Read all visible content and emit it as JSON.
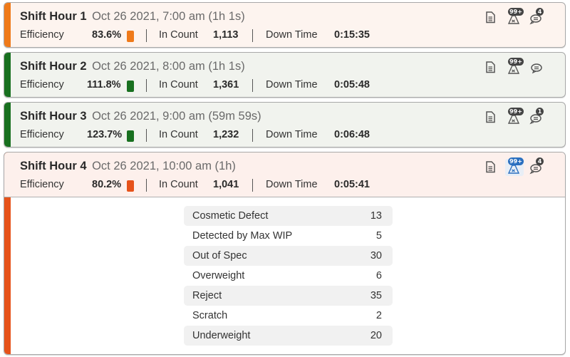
{
  "colors": {
    "orange": "#ef7a1a",
    "green": "#18701f",
    "red_orange": "#e6521a",
    "bg_orange": "#fdf4ef",
    "bg_green": "#f1f3ee",
    "bg_red": "#fdf0ec",
    "badge_dark": "#444444",
    "badge_blue": "#2a6fbf"
  },
  "labels": {
    "efficiency": "Efficiency",
    "in_count": "In Count",
    "down_time": "Down Time"
  },
  "shifts": [
    {
      "title": "Shift Hour 1",
      "subtitle": "Oct 26 2021, 7:00 am (1h 1s)",
      "efficiency": "83.6%",
      "in_count": "1,113",
      "down_time": "0:15:35",
      "status": "orange",
      "alarm_badge": "99+",
      "comment_badge": "4"
    },
    {
      "title": "Shift Hour 2",
      "subtitle": "Oct 26 2021, 8:00 am (1h 1s)",
      "efficiency": "111.8%",
      "in_count": "1,361",
      "down_time": "0:05:48",
      "status": "green",
      "alarm_badge": "99+",
      "comment_badge": ""
    },
    {
      "title": "Shift Hour 3",
      "subtitle": "Oct 26 2021, 9:00 am (59m 59s)",
      "efficiency": "123.7%",
      "in_count": "1,232",
      "down_time": "0:06:48",
      "status": "green",
      "alarm_badge": "99+",
      "comment_badge": "1"
    },
    {
      "title": "Shift Hour 4",
      "subtitle": "Oct 26 2021, 10:00 am (1h)",
      "efficiency": "80.2%",
      "in_count": "1,041",
      "down_time": "0:05:41",
      "status": "red_orange",
      "alarm_badge": "99+",
      "comment_badge": "4",
      "expanded": true
    }
  ],
  "reject_reasons": [
    {
      "label": "Cosmetic Defect",
      "value": "13"
    },
    {
      "label": "Detected by Max WIP",
      "value": "5"
    },
    {
      "label": "Out of Spec",
      "value": "30"
    },
    {
      "label": "Overweight",
      "value": "6"
    },
    {
      "label": "Reject",
      "value": "35"
    },
    {
      "label": "Scratch",
      "value": "2"
    },
    {
      "label": "Underweight",
      "value": "20"
    }
  ],
  "icons": {
    "document": "document-icon",
    "alarm": "alarm-icon",
    "comment": "comment-icon"
  }
}
